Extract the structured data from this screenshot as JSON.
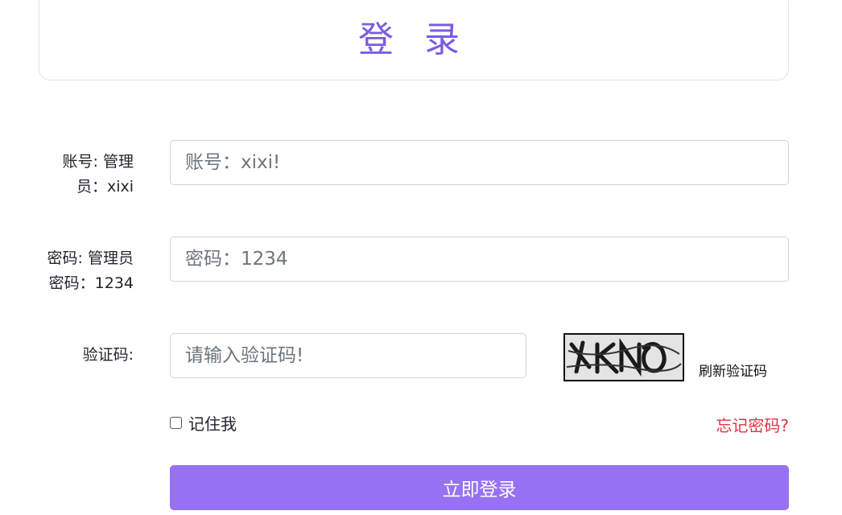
{
  "header": {
    "title": "登 录"
  },
  "form": {
    "account": {
      "label": "账号: 管理员：xixi",
      "placeholder": "账号：xixi!"
    },
    "password": {
      "label": "密码: 管理员密码：1234",
      "placeholder": "密码：1234"
    },
    "captcha": {
      "label": "验证码:",
      "placeholder": "请输入验证码!",
      "image_text": "YKNO",
      "refresh_label": "刷新验证码"
    },
    "remember_label": "记住我",
    "forgot_label": "忘记密码?",
    "submit_label": "立即登录"
  },
  "colors": {
    "title": "#7b5ce0",
    "button": "#9672f2",
    "forgot": "#dc3545"
  }
}
